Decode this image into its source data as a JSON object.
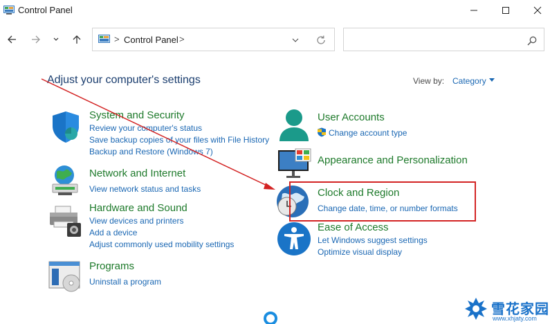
{
  "window": {
    "title": "Control Panel"
  },
  "address": {
    "path": "Control Panel",
    "separator": ">"
  },
  "search": {
    "placeholder": ""
  },
  "main": {
    "heading": "Adjust your computer's settings",
    "view_by_label": "View by:",
    "view_by_value": "Category"
  },
  "categories": [
    {
      "title": "System and Security",
      "links": [
        "Review your computer's status",
        "Save backup copies of your files with File History",
        "Backup and Restore (Windows 7)"
      ]
    },
    {
      "title": "Network and Internet",
      "links": [
        "View network status and tasks"
      ]
    },
    {
      "title": "Hardware and Sound",
      "links": [
        "View devices and printers",
        "Add a device",
        "Adjust commonly used mobility settings"
      ]
    },
    {
      "title": "Programs",
      "links": [
        "Uninstall a program"
      ]
    },
    {
      "title": "User Accounts",
      "links": [
        "Change account type"
      ]
    },
    {
      "title": "Appearance and Personalization",
      "links": []
    },
    {
      "title": "Clock and Region",
      "links": [
        "Change date, time, or number formats"
      ]
    },
    {
      "title": "Ease of Access",
      "links": [
        "Let Windows suggest settings",
        "Optimize visual display"
      ]
    }
  ],
  "watermark": {
    "brand": "雪花家园",
    "url": "www.xhjaty.com"
  },
  "colors": {
    "link": "#1a67b3",
    "category_title": "#1e7a2b",
    "heading": "#1a3d6e",
    "annotation": "#d32323"
  }
}
